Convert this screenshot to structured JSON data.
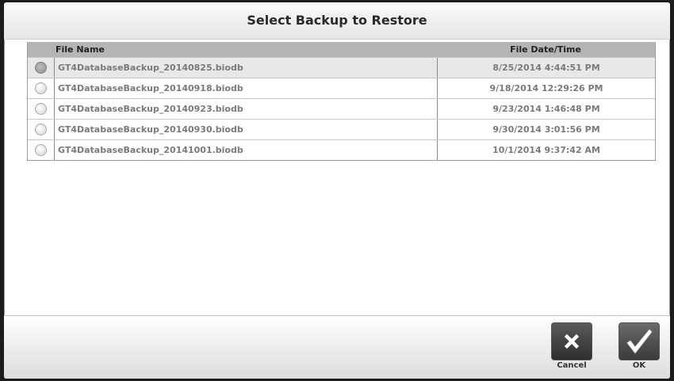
{
  "dialog": {
    "title": "Select Backup to Restore"
  },
  "table": {
    "columns": [
      "File Name",
      "File Date/Time"
    ],
    "rows": [
      {
        "name": "GT4DatabaseBackup_20140825.biodb",
        "date": "8/25/2014 4:44:51 PM",
        "selected": true
      },
      {
        "name": "GT4DatabaseBackup_20140918.biodb",
        "date": "9/18/2014 12:29:26 PM",
        "selected": false
      },
      {
        "name": "GT4DatabaseBackup_20140923.biodb",
        "date": "9/23/2014 1:46:48 PM",
        "selected": false
      },
      {
        "name": "GT4DatabaseBackup_20140930.biodb",
        "date": "9/30/2014 3:01:56 PM",
        "selected": false
      },
      {
        "name": "GT4DatabaseBackup_20141001.biodb",
        "date": "10/1/2014 9:37:42 AM",
        "selected": false
      }
    ]
  },
  "buttons": {
    "cancel": {
      "label": "Cancel",
      "icon": "close-x-icon"
    },
    "ok": {
      "label": "OK",
      "icon": "checkmark-icon"
    }
  }
}
